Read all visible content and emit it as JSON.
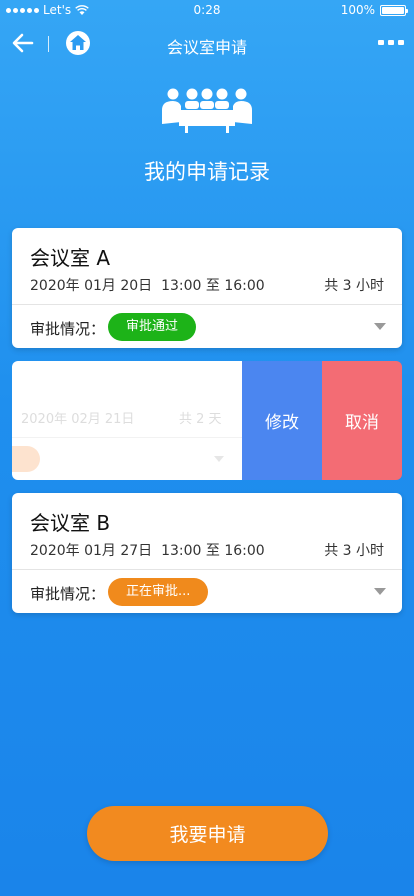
{
  "status_bar": {
    "carrier": "Let's",
    "time": "0:28",
    "battery": "100%"
  },
  "nav": {
    "title": "会议室申请",
    "icons": [
      "back-arrow-icon",
      "home-icon",
      "more-icon"
    ]
  },
  "header": {
    "icon": "meeting-room-icon",
    "title": "我的申请记录"
  },
  "records": [
    {
      "room": "会议室 A",
      "date": "2020年 01月 20日",
      "time_range": "13:00 至 16:00",
      "duration": "共 3 小时",
      "status_label": "审批情况：",
      "status": "审批通过",
      "status_color": "#1db318"
    },
    {
      "date": "2020年 02月 21日",
      "duration": "共 2 天",
      "actions": {
        "edit": "修改",
        "cancel": "取消"
      },
      "edit_color": "#4b86f0",
      "cancel_color": "#f36c74"
    },
    {
      "room": "会议室 B",
      "date": "2020年 01月 27日",
      "time_range": "13:00 至 16:00",
      "duration": "共 3 小时",
      "status_label": "审批情况：",
      "status": "正在审批...",
      "status_color": "#f08a1c"
    }
  ],
  "apply_button": "我要申请",
  "colors": {
    "background": "#2196f3",
    "accent": "#f28a1f"
  }
}
